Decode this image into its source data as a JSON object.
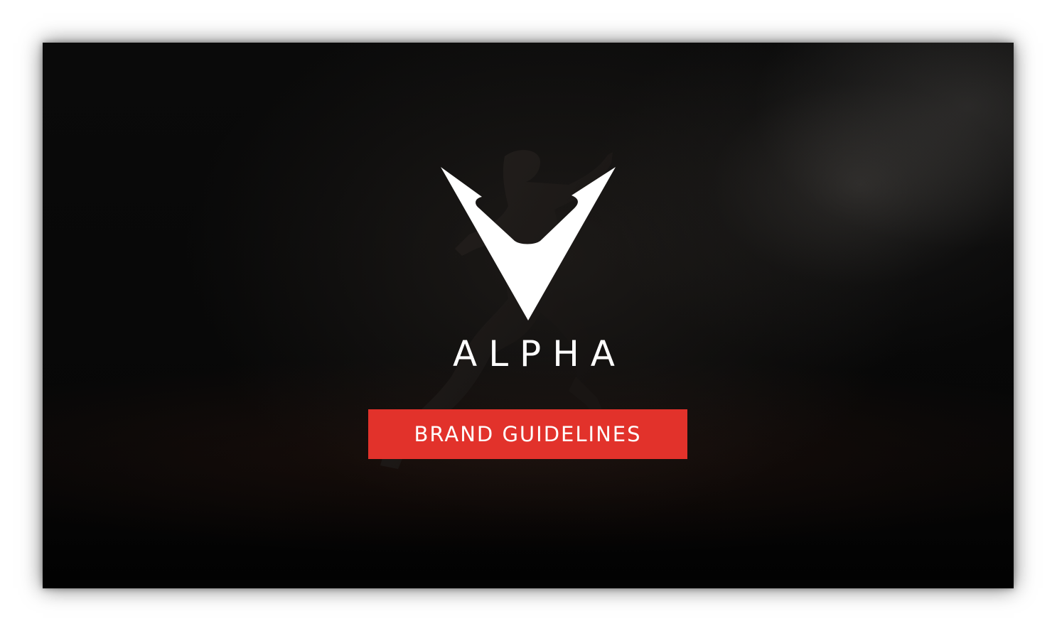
{
  "brand": {
    "logo_icon": "alpha-v-logo",
    "wordmark": "ALPHA"
  },
  "tagline": {
    "label": "BRAND GUIDELINES",
    "background_color": "#e2322b",
    "text_color": "#ffffff"
  },
  "background": {
    "image": "runner-silhouette-in-smoke",
    "base_color": "#050505"
  }
}
